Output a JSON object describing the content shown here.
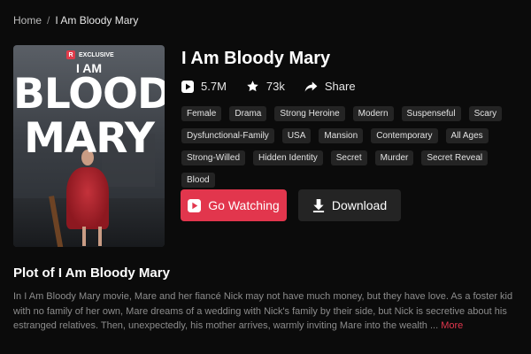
{
  "breadcrumb": {
    "home": "Home",
    "separator": "/",
    "current": "I Am Bloody Mary"
  },
  "poster": {
    "badge": "EXCLUSIVE",
    "badge_letter": "R",
    "line1": "I AM",
    "line2": "BLOODY",
    "line3": "MARY"
  },
  "title": "I Am Bloody Mary",
  "stats": {
    "plays": "5.7M",
    "likes": "73k",
    "share": "Share"
  },
  "tags": [
    "Female",
    "Drama",
    "Strong Heroine",
    "Modern",
    "Suspenseful",
    "Scary",
    "Dysfunctional-Family",
    "USA",
    "Mansion",
    "Contemporary",
    "All Ages",
    "Strong-Willed",
    "Hidden Identity",
    "Secret",
    "Murder",
    "Secret Reveal",
    "Blood"
  ],
  "buttons": {
    "watch": "Go Watching",
    "download": "Download"
  },
  "plot": {
    "heading": "Plot of I Am Bloody Mary",
    "text": "In I Am Bloody Mary movie, Mare and her fiancé Nick may not have much money, but they have love. As a foster kid with no family of her own, Mare dreams of a wedding with Nick's family by their side, but Nick is secretive about his estranged relatives. Then, unexpectedly, his mother arrives, warmly inviting Mare into the wealth",
    "ellipsis": "...",
    "more": "More"
  },
  "colors": {
    "accent": "#e2364d",
    "background": "#0b0b0b",
    "tag_bg": "#242424"
  },
  "icons": {
    "plays": "play-icon",
    "likes": "star-icon",
    "share": "share-icon",
    "watch": "play-icon",
    "download": "download-icon"
  }
}
